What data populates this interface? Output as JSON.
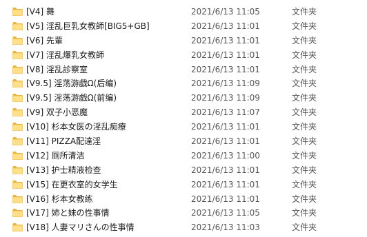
{
  "files": [
    {
      "name": "[V4] 舞",
      "date": "2021/6/13 11:05",
      "type": "文件夹",
      "icon": "folder-icon"
    },
    {
      "name": "[V5] 淫乱巨乳女教師[BIG5+GB]",
      "date": "2021/6/13 11:01",
      "type": "文件夹",
      "icon": "folder-icon"
    },
    {
      "name": "[V6] 先輩",
      "date": "2021/6/13 11:01",
      "type": "文件夹",
      "icon": "folder-icon"
    },
    {
      "name": "[V7] 淫乱爆乳女教師",
      "date": "2021/6/13 11:01",
      "type": "文件夹",
      "icon": "folder-icon"
    },
    {
      "name": "[V8] 淫乱診察室",
      "date": "2021/6/13 11:01",
      "type": "文件夹",
      "icon": "folder-icon"
    },
    {
      "name": "[V9.5] 淫荡游戯Ω(后编)",
      "date": "2021/6/13 11:09",
      "type": "文件夹",
      "icon": "folder-icon"
    },
    {
      "name": "[V9.5] 淫荡游戯Ω(前编)",
      "date": "2021/6/13 11:09",
      "type": "文件夹",
      "icon": "folder-icon"
    },
    {
      "name": "[V9] 双子小恶魔",
      "date": "2021/6/13 11:07",
      "type": "文件夹",
      "icon": "folder-icon"
    },
    {
      "name": "[V10] 杉本女医の淫乱痴療",
      "date": "2021/6/13 11:01",
      "type": "文件夹",
      "icon": "folder-icon"
    },
    {
      "name": "[V11] PIZZA配達淫",
      "date": "2021/6/13 11:01",
      "type": "文件夹",
      "icon": "folder-icon"
    },
    {
      "name": "[V12] 厕所清洁",
      "date": "2021/6/13 11:00",
      "type": "文件夹",
      "icon": "folder-icon"
    },
    {
      "name": "[V13] 护士精液检查",
      "date": "2021/6/13 11:01",
      "type": "文件夹",
      "icon": "folder-icon"
    },
    {
      "name": "[V15] 在更衣室的女学生",
      "date": "2021/6/13 11:01",
      "type": "文件夹",
      "icon": "folder-icon"
    },
    {
      "name": "[V16] 杉本女教练",
      "date": "2021/6/13 11:01",
      "type": "文件夹",
      "icon": "folder-icon"
    },
    {
      "name": "[V17] 姉と妹の性事情",
      "date": "2021/6/13 11:05",
      "type": "文件夹",
      "icon": "folder-icon"
    },
    {
      "name": "[V18] 人妻マリさんの性事情",
      "date": "2021/6/13 11:03",
      "type": "文件夹",
      "icon": "folder-icon"
    }
  ],
  "colors": {
    "folder_body": "#F8D775",
    "folder_tab": "#E8B53A",
    "folder_front": "#FFE08A"
  }
}
